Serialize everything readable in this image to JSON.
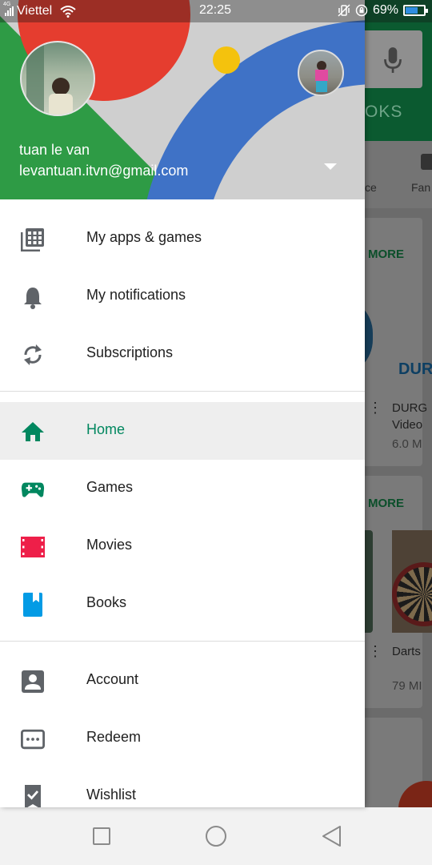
{
  "status_bar": {
    "network_badge": "4G",
    "carrier": "Viettel",
    "time": "22:25",
    "battery_percent": "69%",
    "battery_level": 0.69,
    "battery_color": "#2f8ee0",
    "icons": [
      "signal-icon",
      "wifi-icon",
      "vibrate-icon",
      "rotation-lock-icon",
      "battery-icon"
    ]
  },
  "background": {
    "tab_label_partial": "OKS",
    "chip_1_partial": "ce",
    "chip_2_partial": "Fan",
    "section_1_more": "MORE",
    "section_2_more": "MORE",
    "app_1_title": "DUR",
    "app_1_name": "DURG",
    "app_1_subtitle": "Video",
    "app_1_size": "6.0 M",
    "app_2_name": "Darts",
    "app_2_size": "79 MI"
  },
  "drawer": {
    "header": {
      "user_name": "tuan le van",
      "user_email": "levantuan.itvn@gmail.com",
      "colors": {
        "red": "#e53d2f",
        "blue": "#3f72c6",
        "green": "#2e9b45",
        "yellow": "#f4c20d",
        "gray": "#cfcfcf"
      }
    },
    "section_1": [
      {
        "label": "My apps & games",
        "icon": "apps-grid-icon"
      },
      {
        "label": "My notifications",
        "icon": "bell-icon"
      },
      {
        "label": "Subscriptions",
        "icon": "refresh-icon"
      }
    ],
    "section_2": [
      {
        "label": "Home",
        "icon": "home-icon",
        "active": true
      },
      {
        "label": "Games",
        "icon": "gamepad-icon"
      },
      {
        "label": "Movies",
        "icon": "film-icon"
      },
      {
        "label": "Books",
        "icon": "book-icon"
      }
    ],
    "section_3": [
      {
        "label": "Account",
        "icon": "account-icon"
      },
      {
        "label": "Redeem",
        "icon": "redeem-icon"
      },
      {
        "label": "Wishlist",
        "icon": "wishlist-icon"
      }
    ],
    "accent_color": "#01875f"
  },
  "nav_bar": {
    "buttons": [
      "recents-button",
      "home-button",
      "back-button"
    ]
  }
}
